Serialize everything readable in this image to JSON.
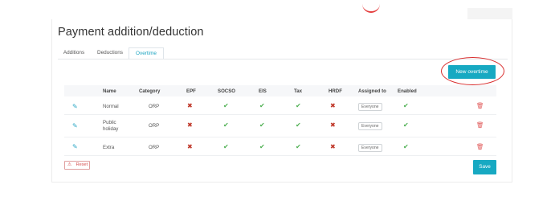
{
  "title": "Payment addition/deduction",
  "tabs": [
    "Additions",
    "Deductions",
    "Overtime"
  ],
  "active_tab": "Overtime",
  "new_button": "New overtime",
  "headers": [
    "Name",
    "Category",
    "EPF",
    "SOCSO",
    "EIS",
    "Tax",
    "HRDF",
    "Assigned to",
    "Enabled"
  ],
  "rows": [
    {
      "name": "Normal",
      "category": "ORP",
      "epf": "✖",
      "socso": "✔",
      "eis": "✔",
      "tax": "✔",
      "hrdf": "✖",
      "assigned": "Everyone",
      "enabled": "✔"
    },
    {
      "name": "Public holiday",
      "category": "ORP",
      "epf": "✖",
      "socso": "✔",
      "eis": "✔",
      "tax": "✔",
      "hrdf": "✖",
      "assigned": "Everyone",
      "enabled": "✔"
    },
    {
      "name": "Extra",
      "category": "ORP",
      "epf": "✖",
      "socso": "✔",
      "eis": "✔",
      "tax": "✔",
      "hrdf": "✖",
      "assigned": "Everyone",
      "enabled": "✔"
    }
  ],
  "icons": {
    "edit": "pencil-icon",
    "delete": "trash-icon",
    "reset": "warning-icon"
  },
  "actions": {
    "reset": "Reset",
    "save": "Save"
  },
  "colors": {
    "accent": "#17a9c2",
    "success": "#4caf50",
    "danger": "#c0392b",
    "highlight": "#d92c2c"
  }
}
